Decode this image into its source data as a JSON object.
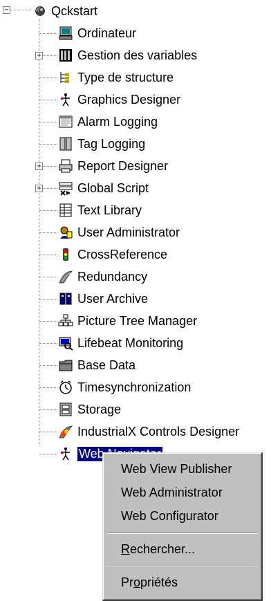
{
  "tree": {
    "root": {
      "label": "Qckstart",
      "icon": "project-icon",
      "expander": "−"
    },
    "items": [
      {
        "label": "Ordinateur",
        "icon": "computer-icon",
        "expander": ""
      },
      {
        "label": "Gestion des variables",
        "icon": "tag-management-icon",
        "expander": "+"
      },
      {
        "label": "Type de structure",
        "icon": "structure-type-icon",
        "expander": ""
      },
      {
        "label": "Graphics Designer",
        "icon": "graphics-designer-icon",
        "expander": ""
      },
      {
        "label": "Alarm Logging",
        "icon": "alarm-logging-icon",
        "expander": ""
      },
      {
        "label": "Tag Logging",
        "icon": "tag-logging-icon",
        "expander": ""
      },
      {
        "label": "Report Designer",
        "icon": "printer-icon",
        "expander": "+"
      },
      {
        "label": "Global Script",
        "icon": "global-script-icon",
        "expander": "+"
      },
      {
        "label": "Text Library",
        "icon": "text-library-icon",
        "expander": ""
      },
      {
        "label": "User Administrator",
        "icon": "user-admin-icon",
        "expander": ""
      },
      {
        "label": "CrossReference",
        "icon": "traffic-light-icon",
        "expander": ""
      },
      {
        "label": "Redundancy",
        "icon": "redundancy-icon",
        "expander": ""
      },
      {
        "label": "User Archive",
        "icon": "user-archive-icon",
        "expander": ""
      },
      {
        "label": "Picture Tree Manager",
        "icon": "picture-tree-icon",
        "expander": ""
      },
      {
        "label": "Lifebeat Monitoring",
        "icon": "lifebeat-icon",
        "expander": ""
      },
      {
        "label": "Base Data",
        "icon": "folder-icon",
        "expander": ""
      },
      {
        "label": "Timesynchronization",
        "icon": "clock-icon",
        "expander": ""
      },
      {
        "label": "Storage",
        "icon": "storage-icon",
        "expander": ""
      },
      {
        "label": "IndustrialX Controls Designer",
        "icon": "controls-designer-icon",
        "expander": ""
      },
      {
        "label": "Web Navigator",
        "icon": "web-navigator-icon",
        "expander": "",
        "selected": true
      }
    ]
  },
  "context_menu": {
    "items": [
      {
        "label": "Web View Publisher"
      },
      {
        "label": "Web Administrator"
      },
      {
        "label": "Web Configurator"
      },
      {
        "label_pre": "",
        "label_ul": "R",
        "label_post": "echercher..."
      },
      {
        "label_pre": "Pr",
        "label_ul": "o",
        "label_post": "priétés"
      }
    ]
  },
  "colors": {
    "selection": "#000080",
    "menu_bg": "#c0c0c0"
  }
}
